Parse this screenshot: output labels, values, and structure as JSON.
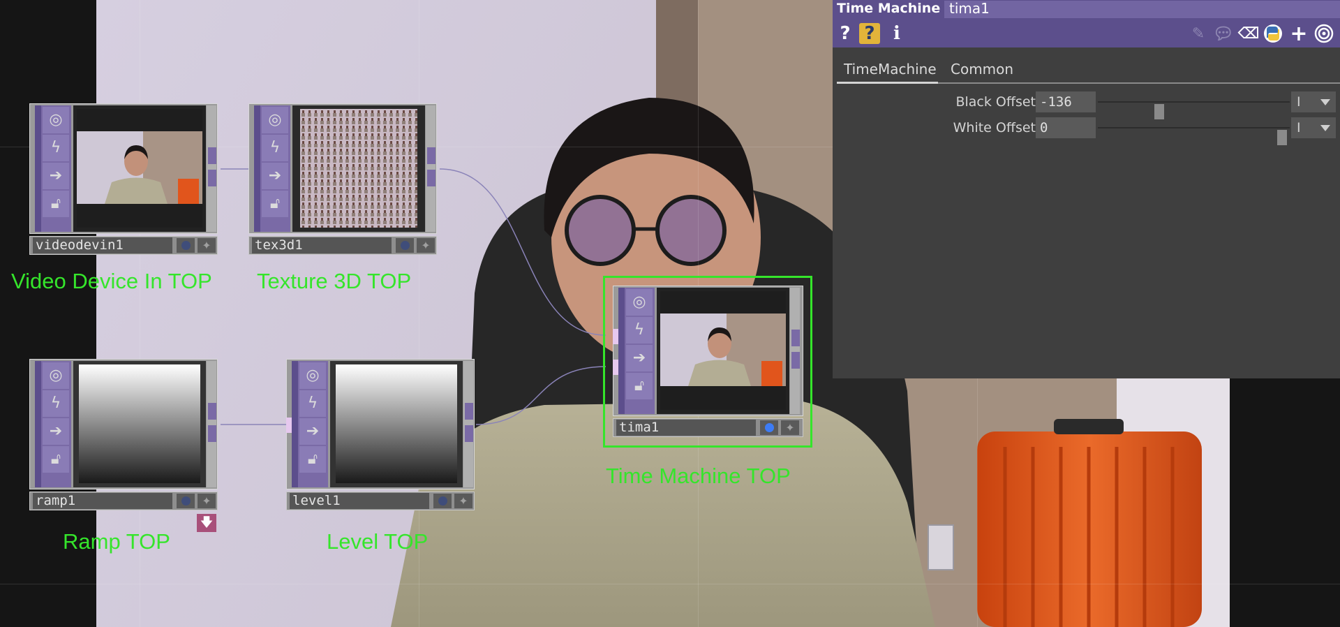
{
  "panel": {
    "operator_type": "Time Machine",
    "operator_name": "tima1",
    "toolbar": {
      "help_icon": "question-icon",
      "python_help_icon": "python-help-icon",
      "info_icon": "info-icon",
      "edit_icon": "pencil-icon",
      "comment_icon": "speech-bubble-icon",
      "clear_icon": "eraser-icon",
      "python_icon": "python-logo-icon",
      "add_icon": "plus-icon",
      "target_icon": "target-icon"
    },
    "tabs": [
      "TimeMachine",
      "Common"
    ],
    "params": [
      {
        "label": "Black Offset",
        "value": "-136",
        "slider": 0.32,
        "menu": "I"
      },
      {
        "label": "White Offset",
        "value": "0",
        "slider": 0.96,
        "menu": "I"
      }
    ]
  },
  "nodes": [
    {
      "name": "videodevin1",
      "caption": "Video Device In TOP"
    },
    {
      "name": "tex3d1",
      "caption": "Texture 3D TOP"
    },
    {
      "name": "ramp1",
      "caption": "Ramp TOP"
    },
    {
      "name": "level1",
      "caption": "Level TOP"
    },
    {
      "name": "tima1",
      "caption": "Time Machine TOP"
    }
  ],
  "colors": {
    "caption": "#35e52b",
    "node_side": "#7a6aa6",
    "panel_header": "#5c4f8c",
    "selection": "#35e52b",
    "viewer_active_dot": "#3d7cf5"
  }
}
